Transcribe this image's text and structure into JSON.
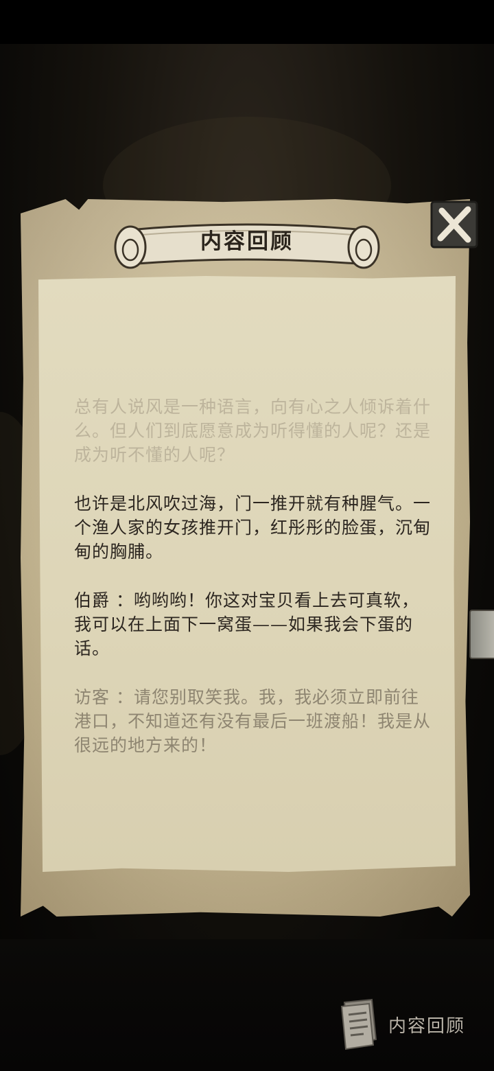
{
  "dialog": {
    "title": "内容回顾",
    "paragraphs": [
      "总有人说风是一种语言，向有心之人倾诉着什么。但人们到底愿意成为听得懂的人呢？还是成为听不懂的人呢？",
      "也许是北风吹过海，门一推开就有种腥气。一个渔人家的女孩推开门，红彤彤的脸蛋，沉甸甸的胸脯。",
      "伯爵 ：哟哟哟！你这对宝贝看上去可真软，我可以在上面下一窝蛋——如果我会下蛋的话。",
      "访客 ：请您别取笑我。我，我必须立即前往港口，不知道还有没有最后一班渡船！我是从很远的地方来的！"
    ]
  },
  "bottom_nav": {
    "label": "内容回顾",
    "icon": "scroll-notes-icon"
  },
  "colors": {
    "parchment": "#cfc2a2",
    "note_paper": "#e2dbbf",
    "ink": "#2c2620"
  }
}
